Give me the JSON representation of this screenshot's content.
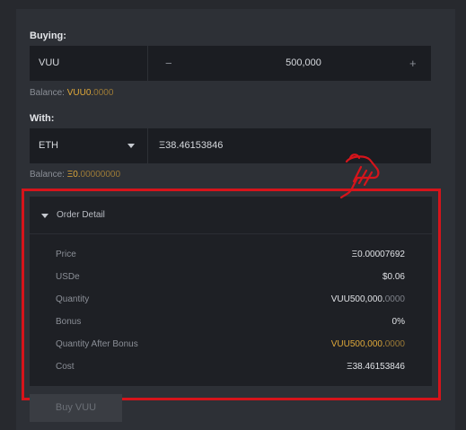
{
  "buying": {
    "label": "Buying:",
    "token": "VUU",
    "minus": "−",
    "amount": "500,000",
    "plus": "+",
    "balance_label": "Balance: ",
    "balance_main": "VUU0.",
    "balance_dim": "0000"
  },
  "with": {
    "label": "With:",
    "currency": "ETH",
    "amount": "Ξ38.46153846",
    "balance_label": "Balance: ",
    "balance_main": "Ξ0.",
    "balance_dim": "00000000"
  },
  "order_detail": {
    "title": "Order Detail",
    "rows": [
      {
        "label": "Price",
        "value": "Ξ0.00007692"
      },
      {
        "label": "USDe",
        "value": "$0.06"
      },
      {
        "label": "Quantity",
        "value_main": "VUU500,000.",
        "value_dim": "0000"
      },
      {
        "label": "Bonus",
        "value": "0%"
      },
      {
        "label": "Quantity After Bonus",
        "value_main": "VUU500,000.",
        "value_dim": "0000"
      },
      {
        "label": "Cost",
        "value": "Ξ38.46153846"
      }
    ]
  },
  "buy_button": "Buy VUU",
  "colors": {
    "accent": "#e0a93a",
    "highlight": "#d6141b",
    "background": "#27292e"
  },
  "icons": {
    "pointer": "pointing-hand-icon",
    "caret": "caret-down-icon"
  }
}
